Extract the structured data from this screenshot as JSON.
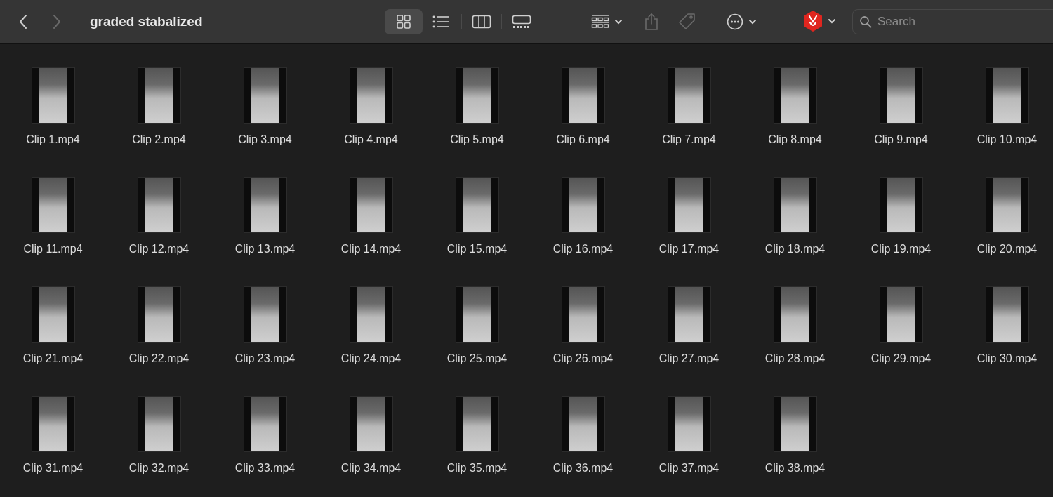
{
  "window": {
    "title": "graded stabalized"
  },
  "nav": [
    {
      "kind": "back",
      "disabled": false
    },
    {
      "kind": "forward",
      "disabled": true
    }
  ],
  "views": [
    {
      "kind": "icons",
      "selected": true
    },
    {
      "kind": "list",
      "selected": false
    },
    {
      "kind": "columns",
      "selected": false
    },
    {
      "kind": "gallery",
      "selected": false
    }
  ],
  "actions": [
    {
      "kind": "group",
      "disabled": false
    },
    {
      "kind": "share",
      "disabled": true
    },
    {
      "kind": "tag",
      "disabled": true
    },
    {
      "kind": "more",
      "disabled": false
    },
    {
      "kind": "extension"
    }
  ],
  "search": {
    "placeholder": "Search"
  },
  "files": [
    "Clip 1.mp4",
    "Clip 2.mp4",
    "Clip 3.mp4",
    "Clip 4.mp4",
    "Clip 5.mp4",
    "Clip 6.mp4",
    "Clip 7.mp4",
    "Clip 8.mp4",
    "Clip 9.mp4",
    "Clip 10.mp4",
    "Clip 11.mp4",
    "Clip 12.mp4",
    "Clip 13.mp4",
    "Clip 14.mp4",
    "Clip 15.mp4",
    "Clip 16.mp4",
    "Clip 17.mp4",
    "Clip 18.mp4",
    "Clip 19.mp4",
    "Clip 20.mp4",
    "Clip 21.mp4",
    "Clip 22.mp4",
    "Clip 23.mp4",
    "Clip 24.mp4",
    "Clip 25.mp4",
    "Clip 26.mp4",
    "Clip 27.mp4",
    "Clip 28.mp4",
    "Clip 29.mp4",
    "Clip 30.mp4",
    "Clip 31.mp4",
    "Clip 32.mp4",
    "Clip 33.mp4",
    "Clip 34.mp4",
    "Clip 35.mp4",
    "Clip 36.mp4",
    "Clip 37.mp4",
    "Clip 38.mp4"
  ]
}
